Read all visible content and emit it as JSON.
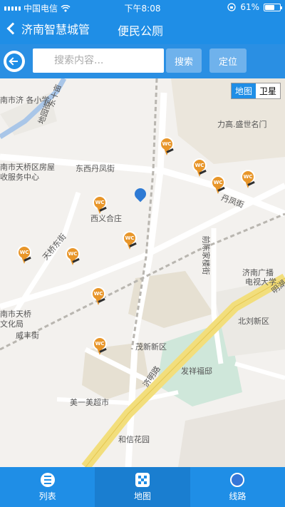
{
  "status_bar": {
    "carrier": "中国电信",
    "time": "下午8:08",
    "battery": "61%"
  },
  "nav": {
    "back_label": "济南智慧城管",
    "title": "便民公厕"
  },
  "search": {
    "placeholder": "搜索内容...",
    "search_button": "搜索",
    "locate_button": "定位"
  },
  "map": {
    "type_toggle": {
      "map": "地图",
      "satellite": "卫星",
      "selected": "地图"
    },
    "labels": {
      "school": "南市济\n各小学",
      "east_road": "东十亩",
      "east_road2": "地园街",
      "lixia": "力高.盛世名门",
      "tianqiao_house": "南市天桥区房屋",
      "tianqiao_house2": "收服务中心",
      "dongxi_st": "东西丹凤街",
      "dan_st": "丹凤街",
      "xiyi": "西义合庄",
      "tianqiao_east": "天桥东街",
      "qianchen": "前陈家楼街",
      "broadcast_uni": "济南广播",
      "broadcast_uni2": "电视大学",
      "tianqiao_culture": "南市天桥",
      "tianqiao_culture2": "文化局",
      "weifeng": "威丰街",
      "beiliu": "北刘新区",
      "maoxin": "茂新新区",
      "fuxiang": "发祥福邸",
      "jiming": "济明路",
      "mingh": "明湖",
      "meiyimei": "美一美超市",
      "hexin": "和信花园"
    }
  },
  "tabs": [
    {
      "label": "列表",
      "icon": "list-icon"
    },
    {
      "label": "地图",
      "icon": "grid-icon"
    },
    {
      "label": "线路",
      "icon": "route-icon"
    }
  ],
  "colors": {
    "primary": "#1f8ee6",
    "pin": "#e8962a"
  }
}
